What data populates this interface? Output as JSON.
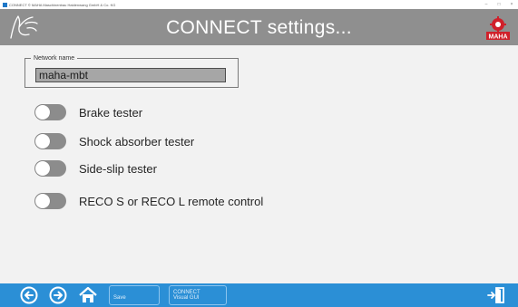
{
  "window": {
    "title": "CONNECT © MAHA Maschinenbau Haldenwang GmbH & Co. KG",
    "controls": [
      "–",
      "□",
      "×"
    ]
  },
  "header": {
    "title": "CONNECT settings...",
    "left_icon": "hand-icon",
    "brand_logo_text": "MAHA"
  },
  "network": {
    "legend": "Network name",
    "value": "maha-mbt"
  },
  "toggles": [
    {
      "label": "Brake tester",
      "on": false
    },
    {
      "label": "Shock absorber tester",
      "on": false
    },
    {
      "label": "Side-slip tester",
      "on": false
    },
    {
      "label": "RECO S or RECO L remote control",
      "on": false
    }
  ],
  "bottombar": {
    "back_icon": "arrow-left-circle-icon",
    "forward_icon": "arrow-right-circle-icon",
    "home_icon": "home-icon",
    "save_label": "Save",
    "connect_label_line1": "CONNECT",
    "connect_label_line2": "Visual GUI",
    "exit_icon": "exit-door-icon"
  },
  "colors": {
    "header_bg": "#8f8f8f",
    "bottombar_bg": "#2b8fd6",
    "toggle_off": "#8c8c8c",
    "logo_red": "#d0202a"
  }
}
